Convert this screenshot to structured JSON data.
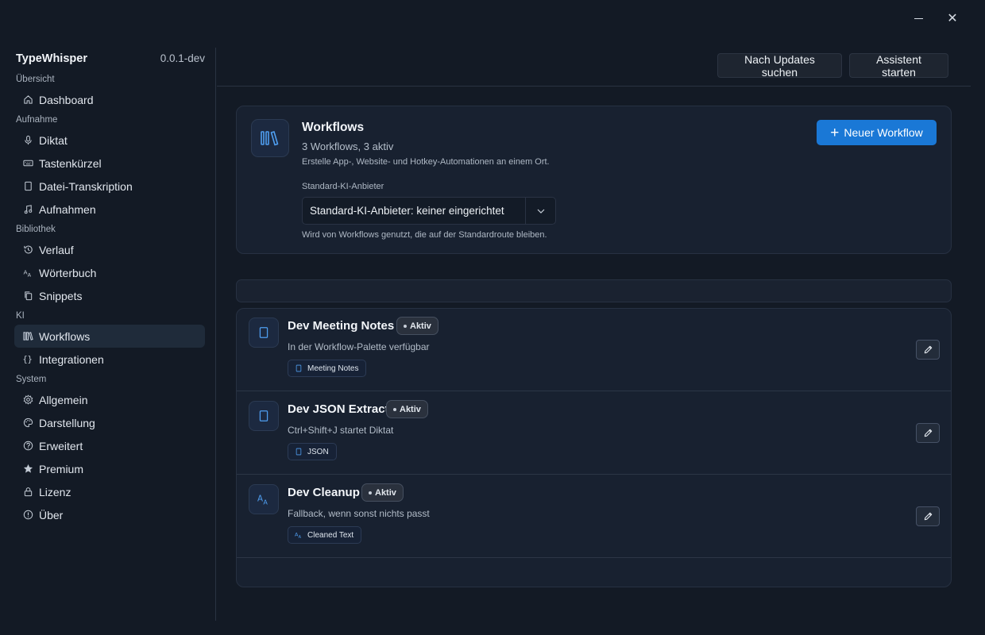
{
  "window": {
    "minimize_icon": "minimize-icon",
    "close_icon": "close-icon",
    "close_glyph": "✕"
  },
  "app": {
    "name": "TypeWhisper",
    "version": "0.0.1-dev"
  },
  "sidebar": {
    "sections": [
      {
        "label": "Übersicht",
        "items": [
          {
            "label": "Dashboard",
            "icon": "home-icon"
          }
        ]
      },
      {
        "label": "Aufnahme",
        "items": [
          {
            "label": "Diktat",
            "icon": "microphone-icon"
          },
          {
            "label": "Tastenkürzel",
            "icon": "keyboard-icon"
          },
          {
            "label": "Datei-Transkription",
            "icon": "document-icon"
          },
          {
            "label": "Aufnahmen",
            "icon": "music-note-icon"
          }
        ]
      },
      {
        "label": "Bibliothek",
        "items": [
          {
            "label": "Verlauf",
            "icon": "history-icon"
          },
          {
            "label": "Wörterbuch",
            "icon": "dictionary-icon"
          },
          {
            "label": "Snippets",
            "icon": "copy-icon"
          }
        ]
      },
      {
        "label": "KI",
        "items": [
          {
            "label": "Workflows",
            "icon": "library-icon",
            "active": true
          },
          {
            "label": "Integrationen",
            "icon": "braces-icon"
          }
        ]
      },
      {
        "label": "System",
        "items": [
          {
            "label": "Allgemein",
            "icon": "gear-icon"
          },
          {
            "label": "Darstellung",
            "icon": "palette-icon"
          },
          {
            "label": "Erweitert",
            "icon": "help-circle-icon"
          },
          {
            "label": "Premium",
            "icon": "star-icon"
          },
          {
            "label": "Lizenz",
            "icon": "lock-icon"
          },
          {
            "label": "Über",
            "icon": "info-icon"
          }
        ]
      }
    ]
  },
  "topbar": {
    "updates_label": "Nach Updates suchen",
    "assistant_label": "Assistent starten"
  },
  "header": {
    "icon": "library-icon",
    "title": "Workflows",
    "count": "3 Workflows, 3 aktiv",
    "description": "Erstelle App-, Website- und Hotkey-Automationen an einem Ort.",
    "provider_label": "Standard-KI-Anbieter",
    "provider_value": "Standard-KI-Anbieter: keiner eingerichtet",
    "provider_hint": "Wird von Workflows genutzt, die auf der Standardroute bleiben.",
    "new_button_label": "Neuer Workflow",
    "accent_color": "#1a78d6"
  },
  "workflows": [
    {
      "name": "Dev Meeting Notes",
      "status": "Aktiv",
      "description": "In der Workflow-Palette verfügbar",
      "chip": "Meeting Notes",
      "icon": "document-icon",
      "chip_icon": "document-icon"
    },
    {
      "name": "Dev JSON Extract",
      "status": "Aktiv",
      "description": "Ctrl+Shift+J startet Diktat",
      "chip": "JSON",
      "icon": "document-icon",
      "chip_icon": "document-icon"
    },
    {
      "name": "Dev Cleanup",
      "status": "Aktiv",
      "description": "Fallback, wenn sonst nichts passt",
      "chip": "Cleaned Text",
      "icon": "text-size-icon",
      "chip_icon": "text-size-icon"
    }
  ]
}
